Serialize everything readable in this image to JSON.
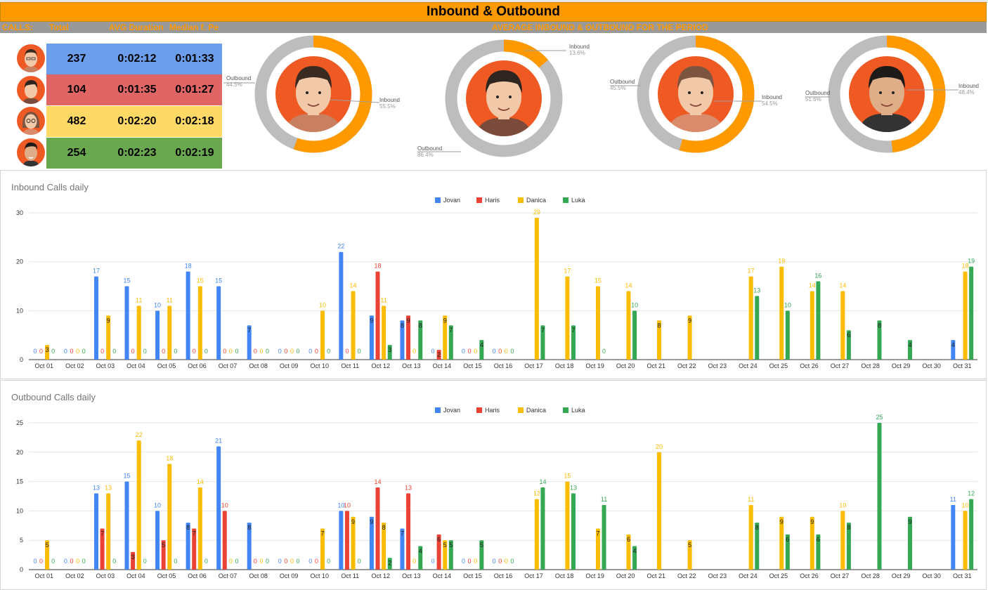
{
  "header": {
    "title": "Inbound & Outbound",
    "calls_label": "CALLS:",
    "total_label": "Total",
    "avg_label": "AVG Duration",
    "median_label": "Median f. Pe",
    "period_label": "AVERAGE INBOUND & OUTBOUND FOR THE PERIOD"
  },
  "summary": [
    {
      "total": "237",
      "avg": "0:02:12",
      "median": "0:01:33",
      "color": "#6d9eeb"
    },
    {
      "total": "104",
      "avg": "0:01:35",
      "median": "0:01:27",
      "color": "#e06666"
    },
    {
      "total": "482",
      "avg": "0:02:20",
      "median": "0:02:18",
      "color": "#ffd966"
    },
    {
      "total": "254",
      "avg": "0:02:23",
      "median": "0:02:19",
      "color": "#6aa84f"
    }
  ],
  "donuts": [
    {
      "inbound_label": "Inbound",
      "inbound_pct": "55.5%",
      "inbound_value": 55.5,
      "outbound_label": "Outbound",
      "outbound_pct": "44.5%",
      "outbound_value": 44.5
    },
    {
      "inbound_label": "Inbound",
      "inbound_pct": "13.6%",
      "inbound_value": 13.6,
      "outbound_label": "Outbound",
      "outbound_pct": "86.4%",
      "outbound_value": 86.4
    },
    {
      "inbound_label": "Inbound",
      "inbound_pct": "54.5%",
      "inbound_value": 54.5,
      "outbound_label": "Outbound",
      "outbound_pct": "45.5%",
      "outbound_value": 45.5
    },
    {
      "inbound_label": "Inbound",
      "inbound_pct": "48.4%",
      "inbound_value": 48.4,
      "outbound_label": "Outbound",
      "outbound_pct": "51.6%",
      "outbound_value": 51.6
    }
  ],
  "colors": {
    "inbound": "#ff9900",
    "outbound": "#bdbdbd",
    "avatar_bg": "#ef5a24"
  },
  "chart_data": [
    {
      "type": "bar",
      "title": "Inbound Calls daily",
      "xlabel": "",
      "ylabel": "",
      "ylim": [
        0,
        30
      ],
      "yticks": [
        0,
        10,
        20,
        30
      ],
      "grid": true,
      "legend": "top-center",
      "categories": [
        "Oct 01",
        "Oct 02",
        "Oct 03",
        "Oct 04",
        "Oct 05",
        "Oct 06",
        "Oct 07",
        "Oct 08",
        "Oct 09",
        "Oct 10",
        "Oct 11",
        "Oct 12",
        "Oct 13",
        "Oct 14",
        "Oct 15",
        "Oct 16",
        "Oct 17",
        "Oct 18",
        "Oct 19",
        "Oct 20",
        "Oct 21",
        "Oct 22",
        "Oct 23",
        "Oct 24",
        "Oct 25",
        "Oct 26",
        "Oct 27",
        "Oct 28",
        "Oct 29",
        "Oct 30",
        "Oct 31"
      ],
      "series": [
        {
          "name": "Jovan",
          "color": "#4285f4",
          "values": [
            0,
            0,
            17,
            15,
            10,
            18,
            15,
            7,
            0,
            0,
            22,
            9,
            8,
            0,
            0,
            0,
            null,
            null,
            null,
            null,
            null,
            null,
            null,
            null,
            null,
            null,
            null,
            null,
            null,
            null,
            4
          ]
        },
        {
          "name": "Haris",
          "color": "#ea4335",
          "values": [
            0,
            0,
            0,
            0,
            0,
            0,
            0,
            0,
            0,
            0,
            0,
            18,
            9,
            2,
            0,
            0,
            null,
            null,
            null,
            null,
            null,
            null,
            null,
            null,
            null,
            null,
            null,
            null,
            null,
            null,
            null
          ]
        },
        {
          "name": "Danica",
          "color": "#fbbc04",
          "values": [
            3,
            0,
            9,
            11,
            11,
            15,
            0,
            0,
            0,
            10,
            14,
            11,
            0,
            9,
            0,
            0,
            29,
            17,
            15,
            14,
            8,
            9,
            null,
            17,
            19,
            14,
            14,
            null,
            null,
            null,
            18
          ]
        },
        {
          "name": "Luka",
          "color": "#34a853",
          "values": [
            0,
            0,
            0,
            0,
            0,
            0,
            0,
            0,
            0,
            0,
            0,
            3,
            8,
            7,
            4,
            0,
            7,
            7,
            0,
            10,
            null,
            null,
            null,
            13,
            10,
            16,
            6,
            8,
            4,
            null,
            19
          ]
        }
      ]
    },
    {
      "type": "bar",
      "title": "Outbound Calls daily",
      "xlabel": "",
      "ylabel": "",
      "ylim": [
        0,
        25
      ],
      "yticks": [
        0,
        5,
        10,
        15,
        20,
        25
      ],
      "grid": true,
      "legend": "top-center",
      "categories": [
        "Oct 01",
        "Oct 02",
        "Oct 03",
        "Oct 04",
        "Oct 05",
        "Oct 06",
        "Oct 07",
        "Oct 08",
        "Oct 09",
        "Oct 10",
        "Oct 11",
        "Oct 12",
        "Oct 13",
        "Oct 14",
        "Oct 15",
        "Oct 16",
        "Oct 17",
        "Oct 18",
        "Oct 19",
        "Oct 20",
        "Oct 21",
        "Oct 22",
        "Oct 23",
        "Oct 24",
        "Oct 25",
        "Oct 26",
        "Oct 27",
        "Oct 28",
        "Oct 29",
        "Oct 30",
        "Oct 31"
      ],
      "series": [
        {
          "name": "Jovan",
          "color": "#4285f4",
          "values": [
            0,
            0,
            13,
            15,
            10,
            8,
            21,
            8,
            0,
            0,
            10,
            9,
            7,
            0,
            0,
            0,
            null,
            null,
            null,
            null,
            null,
            null,
            null,
            null,
            null,
            null,
            null,
            null,
            null,
            null,
            11
          ]
        },
        {
          "name": "Haris",
          "color": "#ea4335",
          "values": [
            0,
            0,
            7,
            3,
            5,
            7,
            10,
            0,
            0,
            0,
            10,
            14,
            13,
            6,
            0,
            0,
            null,
            null,
            null,
            null,
            null,
            null,
            null,
            null,
            null,
            null,
            null,
            null,
            null,
            null,
            null
          ]
        },
        {
          "name": "Danica",
          "color": "#fbbc04",
          "values": [
            5,
            0,
            13,
            22,
            18,
            14,
            0,
            0,
            0,
            7,
            9,
            8,
            0,
            5,
            0,
            0,
            12,
            15,
            7,
            6,
            20,
            5,
            null,
            11,
            9,
            9,
            10,
            null,
            null,
            null,
            10
          ]
        },
        {
          "name": "Luka",
          "color": "#34a853",
          "values": [
            0,
            0,
            0,
            0,
            0,
            0,
            0,
            0,
            0,
            0,
            0,
            2,
            4,
            5,
            5,
            0,
            14,
            13,
            11,
            4,
            null,
            null,
            null,
            8,
            6,
            6,
            8,
            25,
            9,
            null,
            12
          ]
        }
      ]
    }
  ]
}
